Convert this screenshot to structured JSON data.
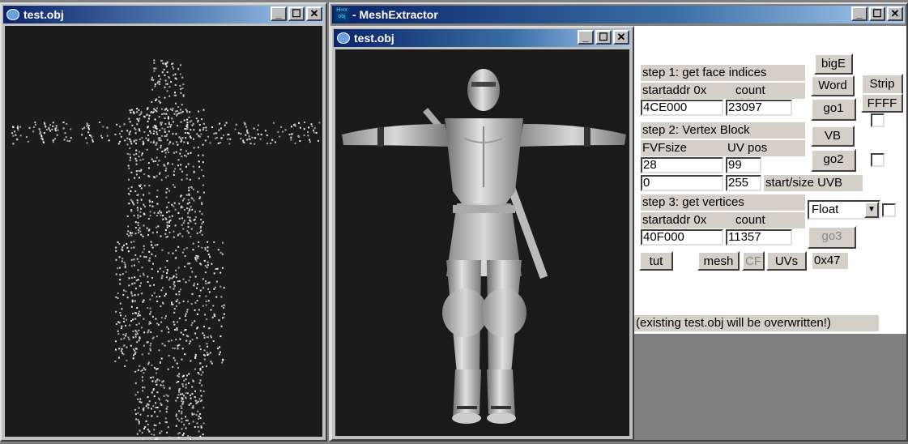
{
  "window_left": {
    "title": "test.obj",
    "buttons": [
      "_",
      "☐",
      "✕"
    ]
  },
  "window_main": {
    "title_logo": "H∞x obj",
    "title": " - MeshExtractor",
    "buttons": [
      "_",
      "☐",
      "✕"
    ],
    "child_window": {
      "title": "test.obj",
      "buttons": [
        "_",
        "☐",
        "✕"
      ]
    },
    "panel": {
      "step1_label": "step 1: get face indices",
      "startaddr_label1": "startaddr 0x",
      "count_label1": "count",
      "startaddr1_value": "4CE000",
      "count1_value": "23097",
      "bigE_button": "bigE",
      "word_button": "Word",
      "strip_button": "Strip",
      "ffff_button": "FFFF",
      "go1_button": "go1",
      "step2_label": "step 2: Vertex Block",
      "fvfsize_label": "FVFsize",
      "uvpos_label": "UV pos",
      "fvfsize_value": "28",
      "uvpos_value": "99",
      "start_value": "0",
      "size_value": "255",
      "start_size_uvb_label": "start/size UVB",
      "vb_button": "VB",
      "go2_button": "go2",
      "step3_label": "step 3: get vertices",
      "startaddr_label3": "startaddr 0x",
      "count_label3": "count",
      "startaddr3_value": "40F000",
      "count3_value": "11357",
      "float_select": "Float",
      "go3_button": "go3",
      "tut_button": "tut",
      "mesh_button": "mesh",
      "cf_button": "CF",
      "uvs_button": "UVs",
      "hex_label": "0x47",
      "warning": "(existing test.obj will be overwritten!)"
    }
  },
  "colors": {
    "title_active": "#0a246a",
    "viewport_bg": "#1c1c1c",
    "panel_bg": "#ffffff",
    "control_bg": "#d4d0c8"
  },
  "icons": {
    "window_icon": "app-window-icon",
    "minimize": "minimize-icon",
    "maximize": "maximize-icon",
    "close": "close-icon"
  }
}
